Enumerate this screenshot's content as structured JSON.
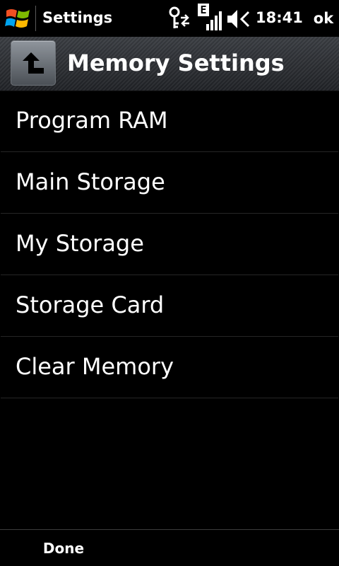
{
  "status_bar": {
    "app_title": "Settings",
    "network_type": "E",
    "time": "18:41",
    "ok_label": "ok",
    "icons": [
      "windows-start-icon",
      "connectivity-icon",
      "signal-strength-icon",
      "speaker-muted-icon"
    ]
  },
  "header": {
    "title": "Memory Settings",
    "back_icon": "up-arrow-icon"
  },
  "menu": {
    "items": [
      {
        "label": "Program RAM"
      },
      {
        "label": "Main Storage"
      },
      {
        "label": "My Storage"
      },
      {
        "label": "Storage Card"
      },
      {
        "label": "Clear Memory"
      }
    ]
  },
  "softkeys": {
    "left_label": "Done"
  },
  "colors": {
    "background": "#000000",
    "text": "#ffffff",
    "header": "#2a2d31",
    "divider": "#262626"
  }
}
